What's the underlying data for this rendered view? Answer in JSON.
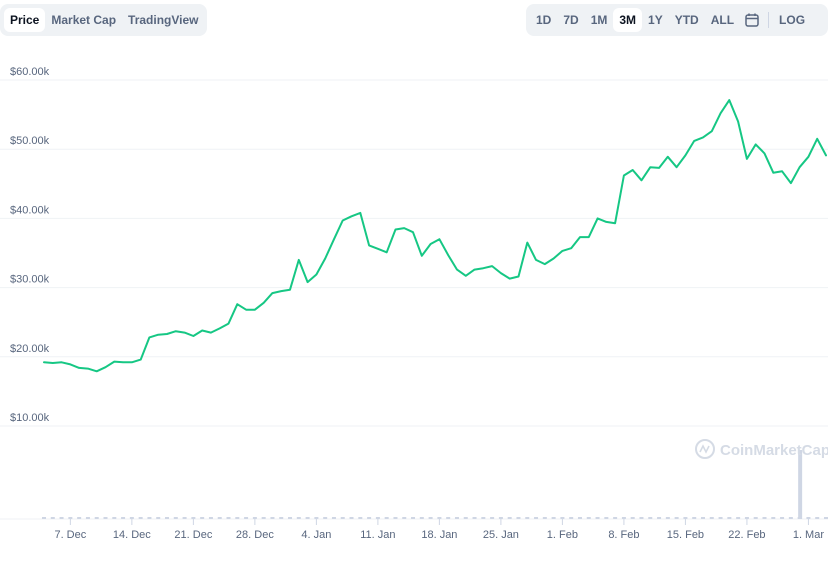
{
  "left_tabs": [
    "Price",
    "Market Cap",
    "TradingView"
  ],
  "left_active": 0,
  "range_tabs": [
    "1D",
    "7D",
    "1M",
    "3M",
    "1Y",
    "YTD",
    "ALL"
  ],
  "range_active": 3,
  "log_label": "LOG",
  "watermark": "CoinMarketCap",
  "colors": {
    "line": "#16c784",
    "grid": "#eff2f5",
    "axis_text": "#58667e",
    "volume": "#cfd6e4"
  },
  "chart_data": {
    "type": "line",
    "ylim": [
      10000,
      60000
    ],
    "yticks": [
      10000,
      20000,
      30000,
      40000,
      50000,
      60000
    ],
    "ytick_labels": [
      "$10.00k",
      "$20.00k",
      "$30.00k",
      "$40.00k",
      "$50.00k",
      "$60.00k"
    ],
    "xticks": [
      "7. Dec",
      "14. Dec",
      "21. Dec",
      "28. Dec",
      "4. Jan",
      "11. Jan",
      "18. Jan",
      "25. Jan",
      "1. Feb",
      "8. Feb",
      "15. Feb",
      "22. Feb",
      "1. Mar"
    ],
    "start_date": "2020-12-04",
    "values": [
      19200,
      19100,
      19200,
      18900,
      18400,
      18300,
      17900,
      18500,
      19300,
      19200,
      19200,
      19600,
      22800,
      23200,
      23300,
      23700,
      23500,
      23000,
      23800,
      23500,
      24100,
      24800,
      27600,
      26800,
      26800,
      27800,
      29200,
      29500,
      29700,
      34000,
      30800,
      31900,
      34200,
      37000,
      39700,
      40300,
      40800,
      36100,
      35600,
      35100,
      38400,
      38600,
      38000,
      34600,
      36300,
      37000,
      34700,
      32600,
      31700,
      32600,
      32800,
      33100,
      32100,
      31300,
      31600,
      36500,
      34000,
      33400,
      34200,
      35300,
      35700,
      37300,
      37300,
      40000,
      39500,
      39300,
      46200,
      47000,
      45500,
      47400,
      47300,
      48900,
      47400,
      49100,
      51200,
      51700,
      52600,
      55200,
      57100,
      54000,
      48600,
      50700,
      49400,
      46600,
      46800,
      45100,
      47400,
      48900,
      51500,
      49100
    ],
    "volume_spike_index": 86
  }
}
